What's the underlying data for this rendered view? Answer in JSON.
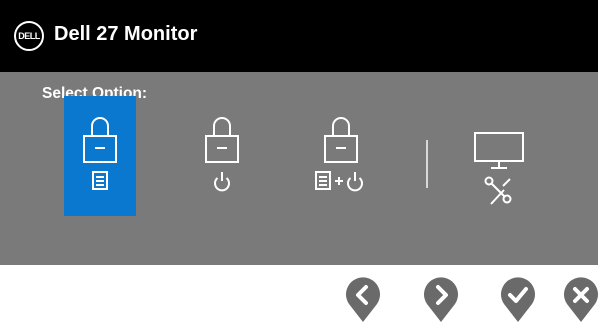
{
  "header": {
    "logo_text": "DELL",
    "title": "Dell 27 Monitor"
  },
  "main": {
    "select_label": "Select Option:",
    "options": [
      {
        "icon": "lock-menu-icon",
        "selected": true
      },
      {
        "icon": "lock-power-icon",
        "selected": false
      },
      {
        "icon": "lock-menu-power-icon",
        "selected": false
      },
      {
        "icon": "monitor-tools-icon",
        "selected": false
      }
    ]
  },
  "nav_buttons": [
    {
      "icon": "left-chevron-icon"
    },
    {
      "icon": "right-chevron-icon"
    },
    {
      "icon": "checkmark-icon"
    },
    {
      "icon": "close-icon"
    }
  ],
  "colors": {
    "header_bg": "#000000",
    "panel_bg": "#7a7a7a",
    "selected_bg": "#0b78cf",
    "nav_button": "#6a6a6a"
  }
}
